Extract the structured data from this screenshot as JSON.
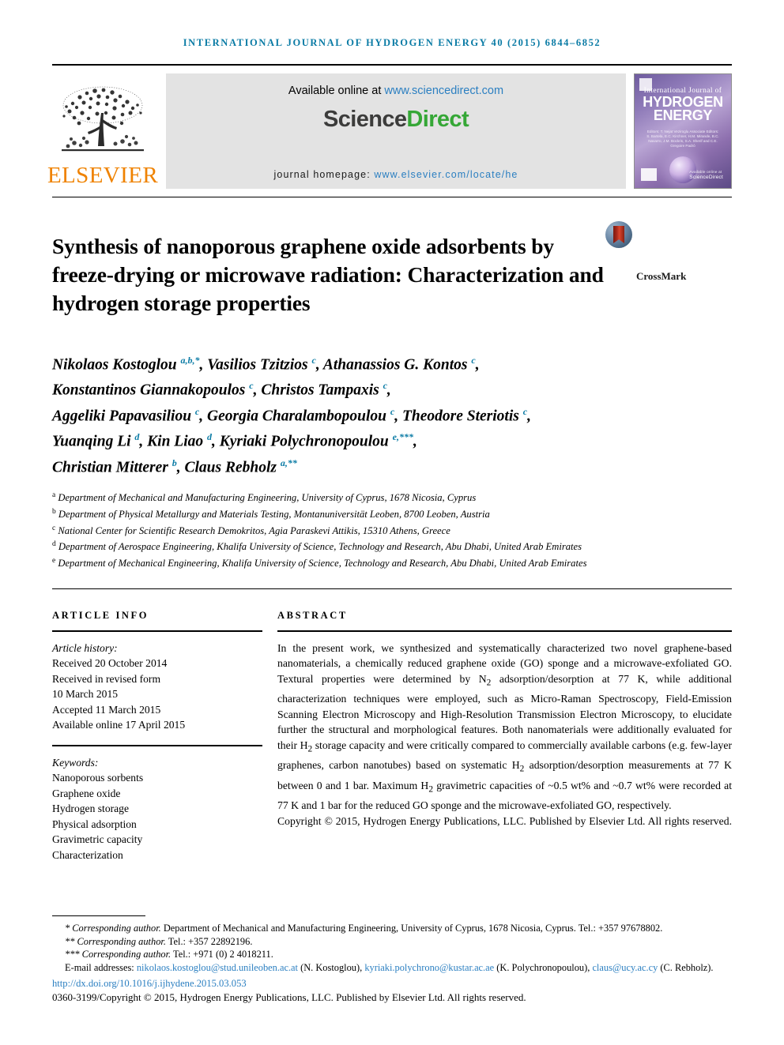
{
  "running_head": "International Journal of Hydrogen Energy 40 (2015) 6844–6852",
  "masthead": {
    "publisher_name": "ELSEVIER",
    "available_prefix": "Available online at ",
    "sciencedirect_url": "www.sciencedirect.com",
    "wordmark_part1": "Science",
    "wordmark_part2": "Direct",
    "homepage_label": "journal homepage: ",
    "homepage_url": "www.elsevier.com/locate/he",
    "cover": {
      "line1": "International Journal of",
      "line2": "HYDROGEN ENERGY",
      "editors": "Editors: T. Nejat Veziroglu\nAssociate Editors: S. Bartela, E.C. Kirchner, H.M. Mirande,\nB.C. Navarro, J.M. Bockris,\nS.A. Sherif and C.E. Gregoire Padró",
      "sd_label": "Available online at",
      "sd_name": "ScienceDirect"
    }
  },
  "title": "Synthesis of nanoporous graphene oxide adsorbents by freeze-drying or microwave radiation: Characterization and hydrogen storage properties",
  "crossmark_label": "CrossMark",
  "authors_html": "Nikolaos Kostoglou <sup>a,b,*</sup>, Vasilios Tzitzios <sup>c</sup>, Athanassios G. Kontos <sup>c</sup>,<br>Konstantinos Giannakopoulos <sup>c</sup>, Christos Tampaxis <sup>c</sup>,<br>Aggeliki Papavasiliou <sup>c</sup>, Georgia Charalambopoulou <sup>c</sup>, Theodore Steriotis <sup>c</sup>,<br>Yuanqing Li <sup>d</sup>, Kin Liao <sup>d</sup>, Kyriaki Polychronopoulou <sup>e,***</sup>,<br>Christian Mitterer <sup>b</sup>, Claus Rebholz <sup>a,**</sup>",
  "affiliations": [
    {
      "mark": "a",
      "text": "Department of Mechanical and Manufacturing Engineering, University of Cyprus, 1678 Nicosia, Cyprus"
    },
    {
      "mark": "b",
      "text": "Department of Physical Metallurgy and Materials Testing, Montanuniversität Leoben, 8700 Leoben, Austria"
    },
    {
      "mark": "c",
      "text": "National Center for Scientific Research Demokritos, Agia Paraskevi Attikis, 15310 Athens, Greece"
    },
    {
      "mark": "d",
      "text": "Department of Aerospace Engineering, Khalifa University of Science, Technology and Research, Abu Dhabi, United Arab Emirates"
    },
    {
      "mark": "e",
      "text": "Department of Mechanical Engineering, Khalifa University of Science, Technology and Research, Abu Dhabi, United Arab Emirates"
    }
  ],
  "article_info": {
    "heading": "ARTICLE INFO",
    "history_label": "Article history:",
    "history": [
      "Received 20 October 2014",
      "Received in revised form",
      "10 March 2015",
      "Accepted 11 March 2015",
      "Available online 17 April 2015"
    ],
    "keywords_label": "Keywords:",
    "keywords": [
      "Nanoporous sorbents",
      "Graphene oxide",
      "Hydrogen storage",
      "Physical adsorption",
      "Gravimetric capacity",
      "Characterization"
    ]
  },
  "abstract": {
    "heading": "ABSTRACT",
    "body_html": "In the present work, we synthesized and systematically characterized two novel graphene-based nanomaterials, a chemically reduced graphene oxide (GO) sponge and a microwave-exfoliated GO. Textural properties were determined by N<sub>2</sub> adsorption/desorption at 77 K, while additional characterization techniques were employed, such as Micro-Raman Spectroscopy, Field-Emission Scanning Electron Microscopy and High-Resolution Transmission Electron Microscopy, to elucidate further the structural and morphological features. Both nanomaterials were additionally evaluated for their H<sub>2</sub> storage capacity and were critically compared to commercially available carbons (e.g. few-layer graphenes, carbon nanotubes) based on systematic H<sub>2</sub> adsorption/desorption measurements at 77 K between 0 and 1 bar. Maximum H<sub>2</sub> gravimetric capacities of ~0.5 wt% and ~0.7 wt% were recorded at 77 K and 1 bar for the reduced GO sponge and the microwave-exfoliated GO, respectively.",
    "copyright": "Copyright © 2015, Hydrogen Energy Publications, LLC. Published by Elsevier Ltd. All rights reserved."
  },
  "footnotes": {
    "note1_html": "<span class=\"ital\">* Corresponding author.</span> Department of Mechanical and Manufacturing Engineering, University of Cyprus, 1678 Nicosia, Cyprus. Tel.: +357 97678802.",
    "note2_html": "<span class=\"ital\">** Corresponding author.</span> Tel.: +357 22892196.",
    "note3_html": "<span class=\"ital\">*** Corresponding author.</span> Tel.: +971 (0) 2 4018211.",
    "emails_label": "E-mail addresses:",
    "emails": [
      {
        "address": "nikolaos.kostoglou@stud.unileoben.ac.at",
        "owner": "(N. Kostoglou)"
      },
      {
        "address": "kyriaki.polychrono@kustar.ac.ae",
        "owner": "(K. Polychronopoulou)"
      },
      {
        "address": "claus@ucy.ac.cy",
        "owner": "(C. Rebholz)."
      }
    ],
    "doi": "http://dx.doi.org/10.1016/j.ijhydene.2015.03.053",
    "issn_line": "0360-3199/Copyright © 2015, Hydrogen Energy Publications, LLC. Published by Elsevier Ltd. All rights reserved."
  },
  "colors": {
    "accent_link": "#2b7fc1",
    "running_head": "#0a7ba5",
    "elsevier_orange": "#ef8200",
    "sciencedirect_green": "#35a736"
  }
}
